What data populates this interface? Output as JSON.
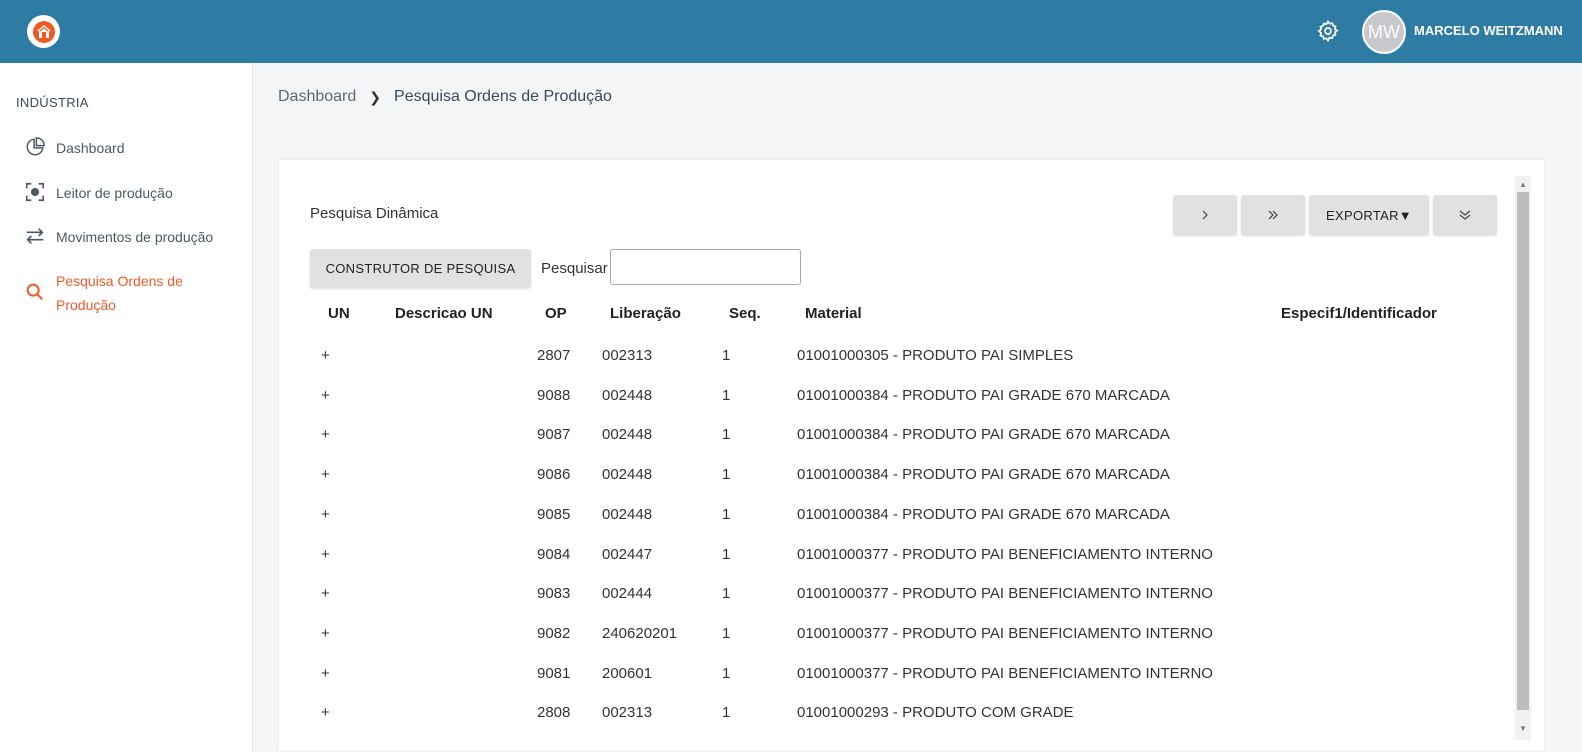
{
  "header": {
    "user_initials": "MW",
    "user_name": "MARCELO WEITZMANN"
  },
  "colors": {
    "topbar": "#2e7ca4",
    "accent": "#ef5a24"
  },
  "sidebar": {
    "section": "INDÚSTRIA",
    "items": [
      {
        "label": "Dashboard",
        "icon": "pie-chart-icon"
      },
      {
        "label": "Leitor de produção",
        "icon": "scan-focus-icon"
      },
      {
        "label": "Movimentos de produção",
        "icon": "swap-arrows-icon"
      },
      {
        "label": "Pesquisa Ordens de Produção",
        "icon": "search-icon",
        "active": true
      }
    ]
  },
  "breadcrumb": {
    "root": "Dashboard",
    "current": "Pesquisa Ordens de Produção"
  },
  "card": {
    "title": "Pesquisa Dinâmica",
    "builder_button": "CONSTRUTOR DE PESQUISA",
    "search_label": "Pesquisar",
    "search_value": "",
    "next_icon": "chevron-right-icon",
    "last_icon": "double-chevron-right-icon",
    "export_button": "EXPORTAR▼",
    "expand_icon": "double-chevron-down-icon"
  },
  "table": {
    "columns": [
      "UN",
      "Descricao UN",
      "OP",
      "Liberação",
      "Seq.",
      "Material",
      "Especif1/Identificador"
    ],
    "rows": [
      {
        "un": "+",
        "desc": "",
        "op": "2807",
        "lib": "002313",
        "seq": "1",
        "material": "01001000305 - PRODUTO PAI SIMPLES",
        "spec": ""
      },
      {
        "un": "+",
        "desc": "",
        "op": "9088",
        "lib": "002448",
        "seq": "1",
        "material": "01001000384 - PRODUTO PAI GRADE 670 MARCADA",
        "spec": ""
      },
      {
        "un": "+",
        "desc": "",
        "op": "9087",
        "lib": "002448",
        "seq": "1",
        "material": "01001000384 - PRODUTO PAI GRADE 670 MARCADA",
        "spec": ""
      },
      {
        "un": "+",
        "desc": "",
        "op": "9086",
        "lib": "002448",
        "seq": "1",
        "material": "01001000384 - PRODUTO PAI GRADE 670 MARCADA",
        "spec": ""
      },
      {
        "un": "+",
        "desc": "",
        "op": "9085",
        "lib": "002448",
        "seq": "1",
        "material": "01001000384 - PRODUTO PAI GRADE 670 MARCADA",
        "spec": ""
      },
      {
        "un": "+",
        "desc": "",
        "op": "9084",
        "lib": "002447",
        "seq": "1",
        "material": "01001000377 - PRODUTO PAI BENEFICIAMENTO INTERNO",
        "spec": ""
      },
      {
        "un": "+",
        "desc": "",
        "op": "9083",
        "lib": "002444",
        "seq": "1",
        "material": "01001000377 - PRODUTO PAI BENEFICIAMENTO INTERNO",
        "spec": ""
      },
      {
        "un": "+",
        "desc": "",
        "op": "9082",
        "lib": "240620201",
        "seq": "1",
        "material": "01001000377 - PRODUTO PAI BENEFICIAMENTO INTERNO",
        "spec": ""
      },
      {
        "un": "+",
        "desc": "",
        "op": "9081",
        "lib": "200601",
        "seq": "1",
        "material": "01001000377 - PRODUTO PAI BENEFICIAMENTO INTERNO",
        "spec": ""
      },
      {
        "un": "+",
        "desc": "",
        "op": "2808",
        "lib": "002313",
        "seq": "1",
        "material": "01001000293 - PRODUTO COM GRADE",
        "spec": ""
      }
    ]
  }
}
